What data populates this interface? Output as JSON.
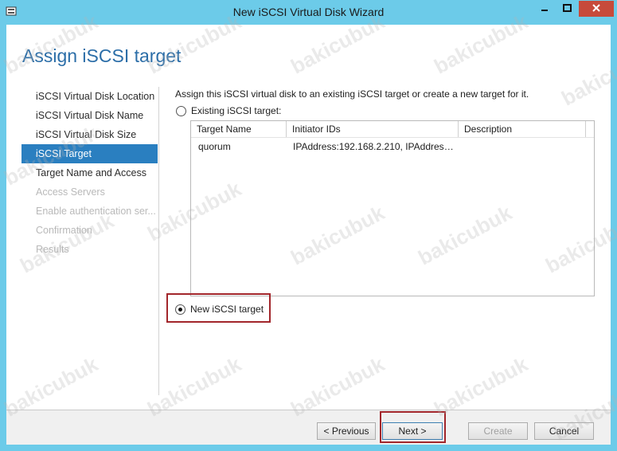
{
  "window": {
    "title": "New iSCSI Virtual Disk Wizard",
    "controls": {
      "minimize_icon": "minimize-icon",
      "maximize_icon": "maximize-icon",
      "close_icon": "close-icon"
    }
  },
  "page": {
    "heading": "Assign iSCSI target"
  },
  "nav": {
    "items": [
      {
        "label": "iSCSI Virtual Disk Location",
        "state": "normal"
      },
      {
        "label": "iSCSI Virtual Disk Name",
        "state": "normal"
      },
      {
        "label": "iSCSI Virtual Disk Size",
        "state": "normal"
      },
      {
        "label": "iSCSI Target",
        "state": "selected"
      },
      {
        "label": "Target Name and Access",
        "state": "normal"
      },
      {
        "label": "Access Servers",
        "state": "disabled"
      },
      {
        "label": "Enable authentication ser...",
        "state": "disabled"
      },
      {
        "label": "Confirmation",
        "state": "disabled"
      },
      {
        "label": "Results",
        "state": "disabled"
      }
    ]
  },
  "content": {
    "intro": "Assign this iSCSI virtual disk to an existing iSCSI target or create a new target for it.",
    "existing_option": {
      "label": "Existing iSCSI target:",
      "checked": false
    },
    "new_option": {
      "label": "New iSCSI target",
      "checked": true
    },
    "table": {
      "columns": [
        "Target Name",
        "Initiator IDs",
        "Description"
      ],
      "rows": [
        {
          "target_name": "quorum",
          "initiator_ids": "IPAddress:192.168.2.210, IPAddress:...",
          "description": ""
        }
      ]
    }
  },
  "buttons": {
    "previous": "< Previous",
    "next": "Next >",
    "create": "Create",
    "cancel": "Cancel"
  },
  "watermark": "bakicubuk",
  "colors": {
    "titlebar": "#6ccbe9",
    "accent": "#2a7fc0",
    "heading": "#2c6ea8",
    "highlight_border": "#a2262b",
    "close_button": "#c74a3b"
  }
}
